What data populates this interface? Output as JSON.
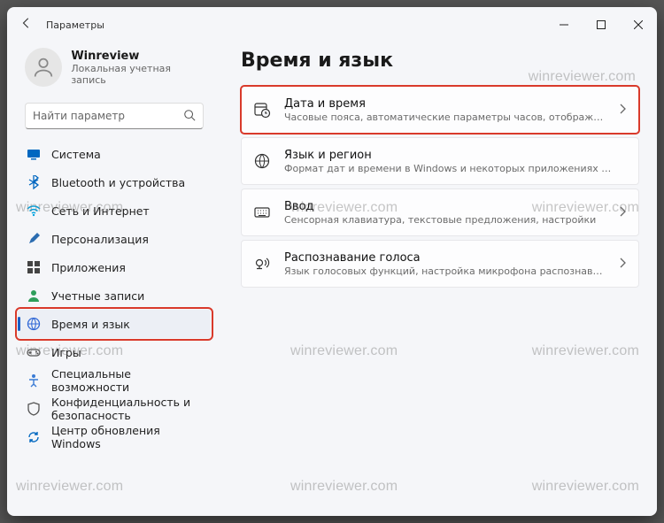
{
  "window": {
    "app_title": "Параметры"
  },
  "user": {
    "name": "Winreview",
    "subtitle": "Локальная учетная запись"
  },
  "search": {
    "placeholder": "Найти параметр"
  },
  "sidebar": {
    "items": [
      {
        "label": "Система",
        "icon": "system",
        "color": "#0067c0"
      },
      {
        "label": "Bluetooth и устройства",
        "icon": "bluetooth",
        "color": "#0067c0"
      },
      {
        "label": "Сеть и Интернет",
        "icon": "wifi",
        "color": "#00a3e0"
      },
      {
        "label": "Персонализация",
        "icon": "brush",
        "color": "#2b6cb0"
      },
      {
        "label": "Приложения",
        "icon": "apps",
        "color": "#444"
      },
      {
        "label": "Учетные записи",
        "icon": "account",
        "color": "#2e9e5b"
      },
      {
        "label": "Время и язык",
        "icon": "globe",
        "color": "#3269d6"
      },
      {
        "label": "Игры",
        "icon": "games",
        "color": "#555"
      },
      {
        "label": "Специальные возможности",
        "icon": "access",
        "color": "#3a7bd5"
      },
      {
        "label": "Конфиденциальность и безопасность",
        "icon": "privacy",
        "color": "#555"
      },
      {
        "label": "Центр обновления Windows",
        "icon": "update",
        "color": "#0067c0"
      }
    ],
    "active_index": 6,
    "highlight_index": 6
  },
  "page": {
    "title": "Время и язык",
    "cards": [
      {
        "title": "Дата и время",
        "subtitle": "Часовые пояса, автоматические параметры часов, отображение календаря",
        "icon": "calendar-clock",
        "chevron": true,
        "highlight": true
      },
      {
        "title": "Язык и регион",
        "subtitle": "Формат дат и времени в Windows и некоторых приложениях в зависимости от региона",
        "icon": "globe-lang",
        "chevron": false,
        "highlight": false
      },
      {
        "title": "Ввод",
        "subtitle": "Сенсорная клавиатура, текстовые предложения, настройки",
        "icon": "keyboard",
        "chevron": true,
        "highlight": false
      },
      {
        "title": "Распознавание голоса",
        "subtitle": "Язык голосовых функций, настройка микрофона распознавания речи, голоса",
        "icon": "speech",
        "chevron": true,
        "highlight": false
      }
    ]
  },
  "watermark": "winreviewer.com"
}
